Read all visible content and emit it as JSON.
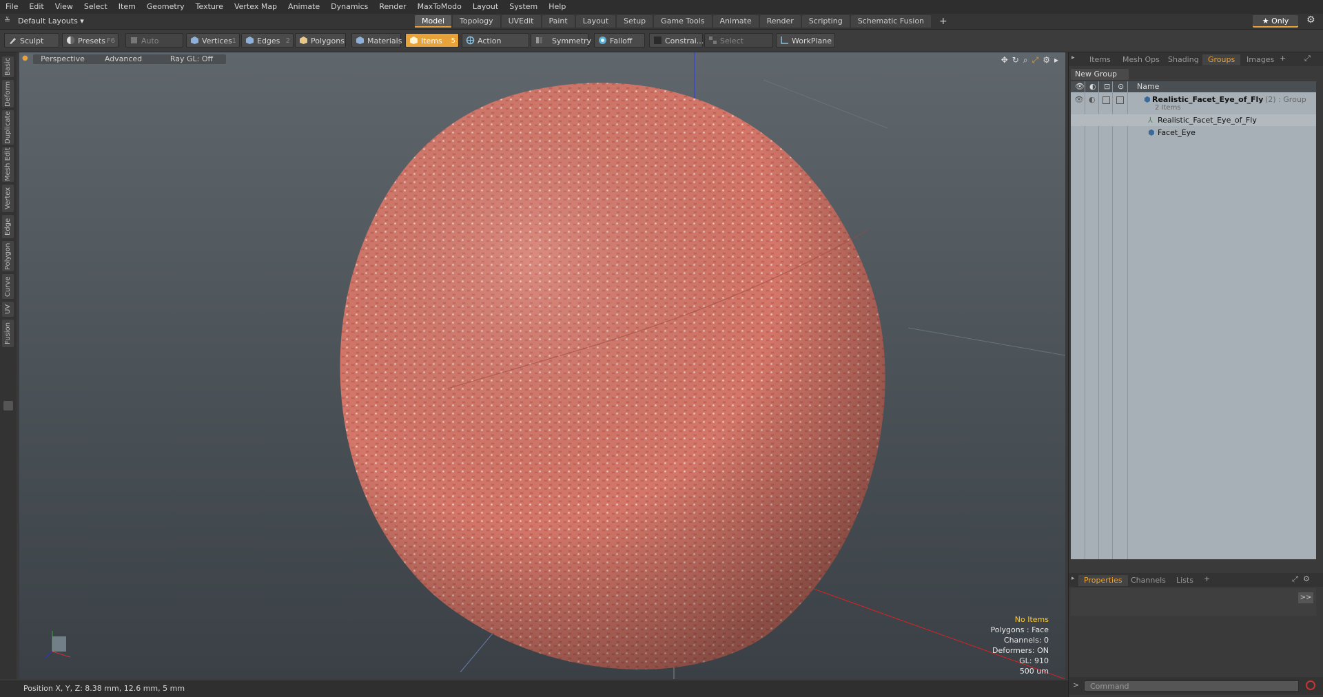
{
  "menu": [
    "File",
    "Edit",
    "View",
    "Select",
    "Item",
    "Geometry",
    "Texture",
    "Vertex Map",
    "Animate",
    "Dynamics",
    "Render",
    "MaxToModo",
    "Layout",
    "System",
    "Help"
  ],
  "layout_dropdown": "Default Layouts ▾",
  "layout_tabs": [
    {
      "label": "Model",
      "active": true
    },
    {
      "label": "Topology",
      "active": false
    },
    {
      "label": "UVEdit",
      "active": false
    },
    {
      "label": "Paint",
      "active": false
    },
    {
      "label": "Layout",
      "active": false
    },
    {
      "label": "Setup",
      "active": false
    },
    {
      "label": "Game Tools",
      "active": false
    },
    {
      "label": "Animate",
      "active": false
    },
    {
      "label": "Render",
      "active": false
    },
    {
      "label": "Scripting",
      "active": false
    },
    {
      "label": "Schematic Fusion",
      "active": false
    }
  ],
  "add_tab": "+",
  "only_label": "★ Only",
  "toolbar": {
    "sculpt": "Sculpt",
    "presets": "Presets",
    "presets_key": "F6",
    "auto_select": "Auto Select",
    "vertices": "Vertices",
    "vertices_key": "1",
    "edges": "Edges",
    "edges_key": "2",
    "polygons": "Polygons",
    "materials": "Materials",
    "items": "Items",
    "items_key": "5",
    "action_center": "Action Center",
    "symmetry": "Symmetry",
    "falloff": "Falloff",
    "constrain": "Constrai...",
    "select_through": "Select Through",
    "workplane": "WorkPlane"
  },
  "left_tabs": [
    "Basic",
    "Deform",
    "Duplicate",
    "Mesh Edit",
    "Vertex",
    "Edge",
    "Polygon",
    "Curve",
    "UV",
    "Fusion"
  ],
  "viewport": {
    "view": "Perspective",
    "shading": "Advanced",
    "raygl": "Ray GL: Off",
    "stats": {
      "items": "No Items",
      "polygons": "Polygons : Face",
      "channels": "Channels: 0",
      "deformers": "Deformers: ON",
      "gl": "GL: 910",
      "scale": "500 um"
    }
  },
  "status": "Position X, Y, Z:   8.38 mm, 12.6 mm, 5 mm",
  "right_panel": {
    "tabs": [
      {
        "label": "Items",
        "active": false
      },
      {
        "label": "Mesh Ops",
        "active": false
      },
      {
        "label": "Shading",
        "active": false
      },
      {
        "label": "Groups",
        "active": true
      },
      {
        "label": "Images",
        "active": false
      }
    ],
    "new_group": "New Group",
    "name_header": "Name",
    "group_name": "Realistic_Facet_Eye_of_Fly",
    "group_suffix": "(2) : Group",
    "group_count": "2 Items",
    "children": [
      "Realistic_Facet_Eye_of_Fly",
      "Facet_Eye"
    ],
    "bottom_tabs": [
      {
        "label": "Properties",
        "active": true
      },
      {
        "label": "Channels",
        "active": false
      },
      {
        "label": "Lists",
        "active": false
      }
    ],
    "expand": ">>",
    "command_placeholder": "Command"
  },
  "colors": {
    "accent": "#e8a23a",
    "sphere": "#c8675a",
    "tree_bg": "#a7b0b6"
  }
}
